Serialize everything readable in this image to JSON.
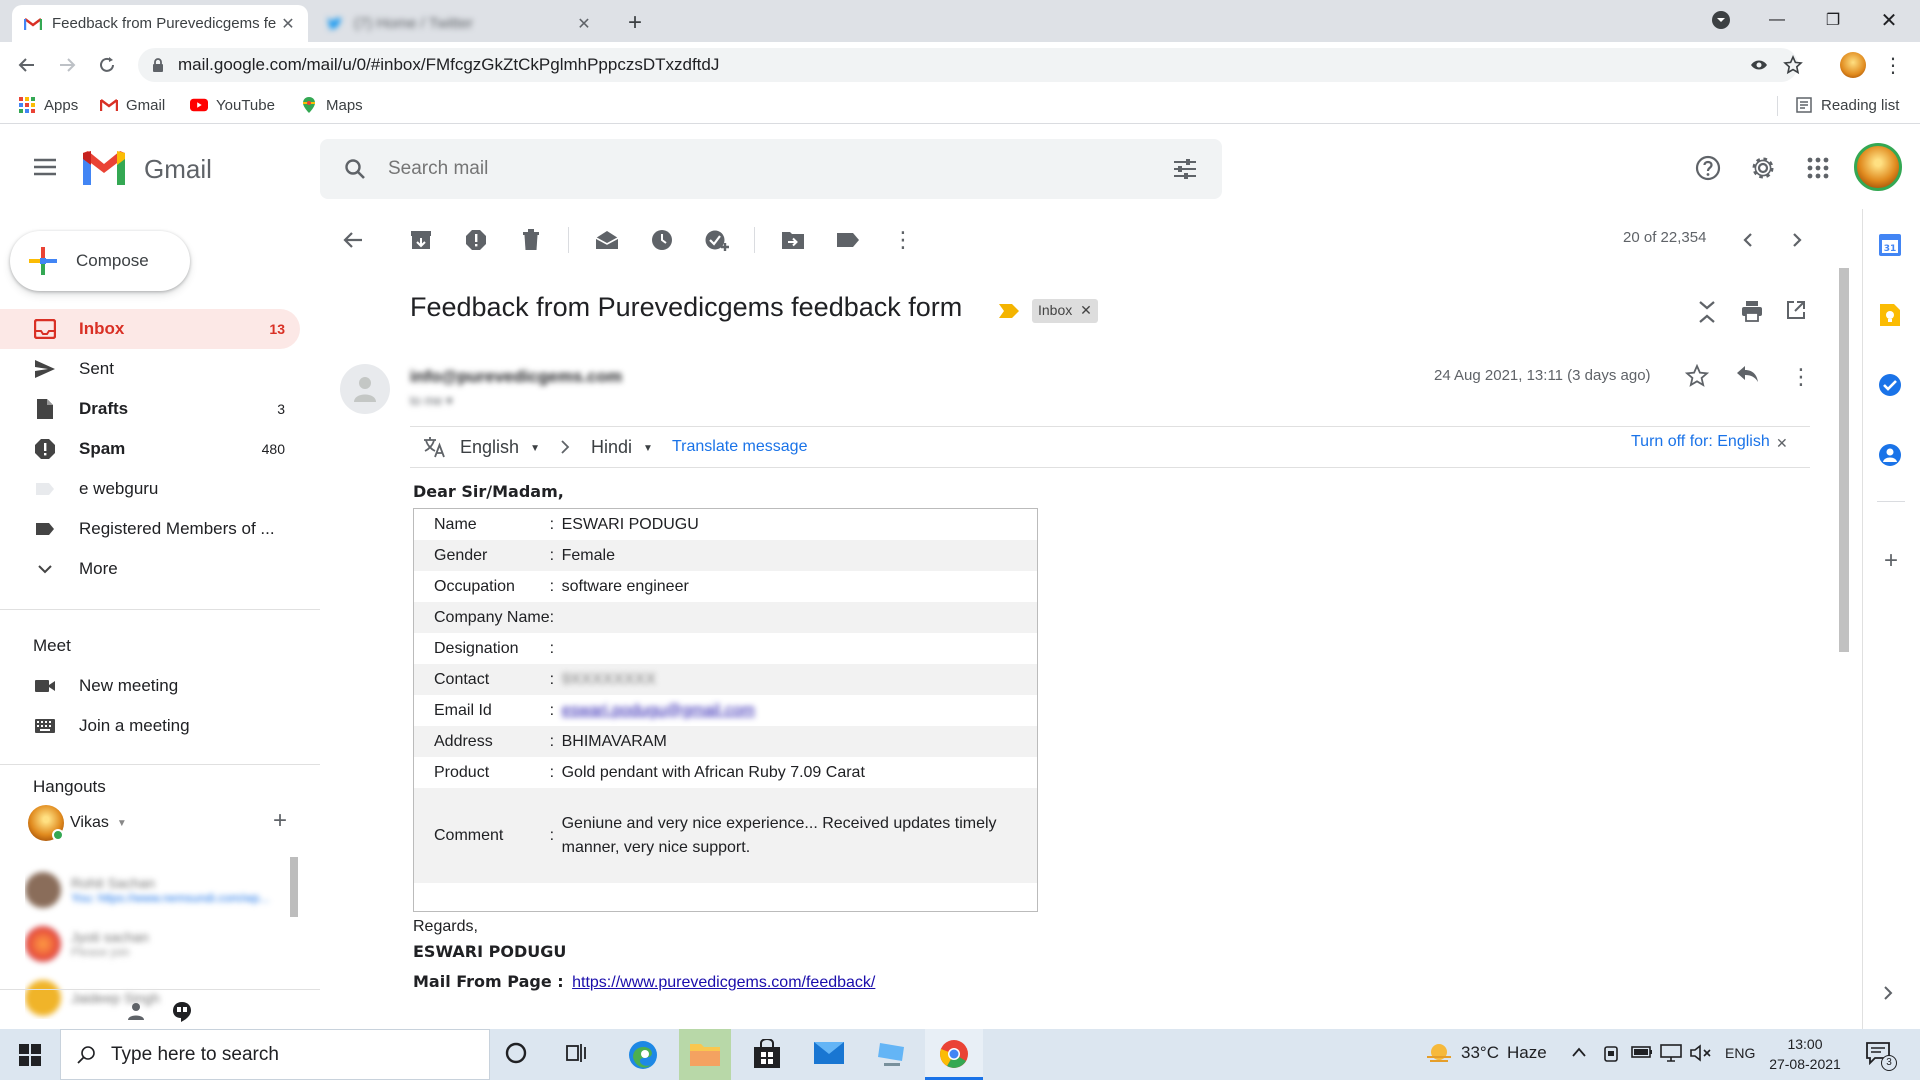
{
  "browser": {
    "tabs": [
      {
        "title": "Feedback from Purevedicgems fe",
        "active": true
      },
      {
        "title": "(7) Home / Twitter",
        "active": false
      }
    ],
    "url": "mail.google.com/mail/u/0/#inbox/FMfcgzGkZtCkPglmhPppczsDTxzdftdJ",
    "bookmarks": [
      "Apps",
      "Gmail",
      "YouTube",
      "Maps"
    ],
    "reading_list": "Reading list"
  },
  "gmail": {
    "logo_text": "Gmail",
    "search_placeholder": "Search mail",
    "compose": "Compose",
    "nav": [
      {
        "label": "Inbox",
        "count": "13"
      },
      {
        "label": "Sent",
        "count": ""
      },
      {
        "label": "Drafts",
        "count": "3"
      },
      {
        "label": "Spam",
        "count": "480"
      },
      {
        "label": "e webguru",
        "count": ""
      },
      {
        "label": "Registered Members of ...",
        "count": ""
      },
      {
        "label": "More",
        "count": ""
      }
    ],
    "meet": {
      "title": "Meet",
      "new_meeting": "New meeting",
      "join": "Join a meeting"
    },
    "hangouts": {
      "title": "Hangouts",
      "user": "Vikas",
      "contacts": [
        {
          "name": "Rohit Sachan",
          "preview": "You: https://www.nemsundi.com/wp..."
        },
        {
          "name": "Jyoti sachan",
          "preview": "Please join"
        },
        {
          "name": "Jaideep Singh",
          "preview": ""
        }
      ]
    },
    "pagination": "20 of 22,354"
  },
  "message": {
    "subject": "Feedback from Purevedicgems feedback form",
    "label_chip": "Inbox",
    "sender": "info@purevedicgems.com",
    "to": "to me",
    "date": "24 Aug 2021, 13:11 (3 days ago)",
    "translate": {
      "from": "English",
      "to": "Hindi",
      "action": "Translate message",
      "turn_off": "Turn off for: English"
    },
    "greeting": "Dear Sir/Madam,",
    "fields": [
      {
        "label": "Name",
        "value": "ESWARI PODUGU",
        "link": false,
        "blur": false
      },
      {
        "label": "Gender",
        "value": "Female",
        "link": false,
        "blur": false
      },
      {
        "label": "Occupation",
        "value": "software engineer",
        "link": false,
        "blur": false
      },
      {
        "label": "Company Name",
        "value": "",
        "link": false,
        "blur": false
      },
      {
        "label": "Designation",
        "value": "",
        "link": false,
        "blur": false
      },
      {
        "label": "Contact",
        "value": "9XXXXXXXX",
        "link": false,
        "blur": true
      },
      {
        "label": "Email Id",
        "value": "eswari.podugu@gmail.com",
        "link": true,
        "blur": true
      },
      {
        "label": "Address",
        "value": "BHIMAVARAM",
        "link": false,
        "blur": false
      },
      {
        "label": "Product",
        "value": "Gold pendant with African Ruby 7.09 Carat",
        "link": false,
        "blur": false
      },
      {
        "label": "Comment",
        "value": "Geniune and very nice experience... Received updates timely manner, very nice support.",
        "link": false,
        "blur": false
      }
    ],
    "regards": "Regards,",
    "signature": "ESWARI PODUGU",
    "mail_from_label": "Mail From Page :",
    "mail_from_url": "https://www.purevedicgems.com/feedback/"
  },
  "taskbar": {
    "search_placeholder": "Type here to search",
    "weather": "33°C",
    "weather_desc": "Haze",
    "lang": "ENG",
    "time": "13:00",
    "date": "27-08-2021",
    "notifications": "3"
  },
  "colors": {
    "gmail_red": "#d93025",
    "inbox_active_bg": "#fce8e6",
    "link_blue": "#1a0dab",
    "taskbar_bg": "#dce6f0",
    "chrome_tab_bg": "#dee1e6"
  }
}
